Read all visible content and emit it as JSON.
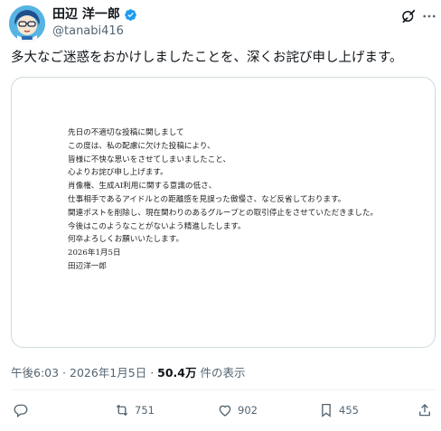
{
  "author": {
    "display_name": "田辺 洋一郎",
    "handle": "@tanabi416",
    "verified": true,
    "verified_color": "#1d9bf0"
  },
  "tweet": {
    "text": "多大なご迷惑をおかけしましたことを、深くお詫び申し上げます。"
  },
  "document": {
    "lines": [
      "先日の不適切な投稿に関しまして",
      "この度は、私の配慮に欠けた投稿により、",
      "皆様に不快な思いをさせてしまいましたこと、",
      "心よりお詫び申し上げます。",
      "肖像権、生成AI利用に関する意識の低さ、",
      "仕事相手であるアイドルとの距離感を見誤った傲慢さ、など反省しております。",
      "関連ポストを削除し、現在関わりのあるグループとの取引停止をさせていただきました。",
      "今後はこのようなことがないよう精進したします。",
      "何卒よろしくお願いいたします。"
    ],
    "date": "2026年1月5日",
    "signature": "田辺洋一郎"
  },
  "meta": {
    "time": "午後6:03",
    "separator1": " · ",
    "date": "2026年1月5日",
    "separator2": " · ",
    "views": "50.4万",
    "views_label": " 件の表示"
  },
  "actions": {
    "reply_icon": "reply-icon",
    "repost_count": "751",
    "like_count": "902",
    "bookmark_count": "455"
  },
  "colors": {
    "text": "#0f1419",
    "secondary": "#536471",
    "accent": "#1d9bf0",
    "border": "#cfd9de"
  }
}
